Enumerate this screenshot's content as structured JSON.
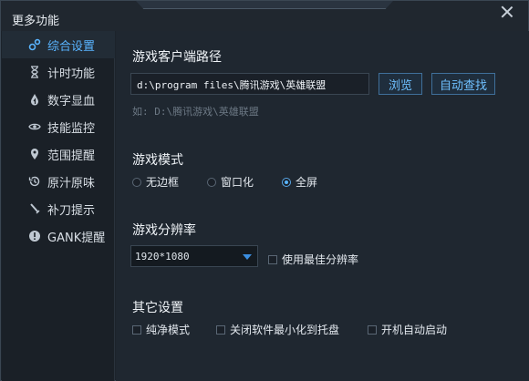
{
  "window": {
    "title": "更多功能"
  },
  "sidebar": {
    "items": [
      {
        "label": "综合设置",
        "icon": "gears-icon",
        "active": true
      },
      {
        "label": "计时功能",
        "icon": "hourglass-icon",
        "active": false
      },
      {
        "label": "数字显血",
        "icon": "blood-drop-icon",
        "active": false
      },
      {
        "label": "技能监控",
        "icon": "eye-icon",
        "active": false
      },
      {
        "label": "范围提醒",
        "icon": "location-pin-icon",
        "active": false
      },
      {
        "label": "原汁原味",
        "icon": "history-icon",
        "active": false
      },
      {
        "label": "补刀提示",
        "icon": "sword-icon",
        "active": false
      },
      {
        "label": "GANK提醒",
        "icon": "alert-icon",
        "active": false
      }
    ]
  },
  "client_path": {
    "title": "游戏客户端路径",
    "value": "d:\\program files\\腾讯游戏\\英雄联盟",
    "browse_label": "浏览",
    "auto_find_label": "自动查找",
    "hint": "如: D:\\腾讯游戏\\英雄联盟"
  },
  "game_mode": {
    "title": "游戏模式",
    "options": [
      "无边框",
      "窗口化",
      "全屏"
    ],
    "selected": "全屏"
  },
  "resolution": {
    "title": "游戏分辨率",
    "value": "1920*1080",
    "best_label": "使用最佳分辨率"
  },
  "other": {
    "title": "其它设置",
    "options": [
      "纯净模式",
      "关闭软件最小化到托盘",
      "开机自动启动"
    ]
  },
  "colors": {
    "accent": "#59b4ff",
    "background": "#1f2730"
  }
}
